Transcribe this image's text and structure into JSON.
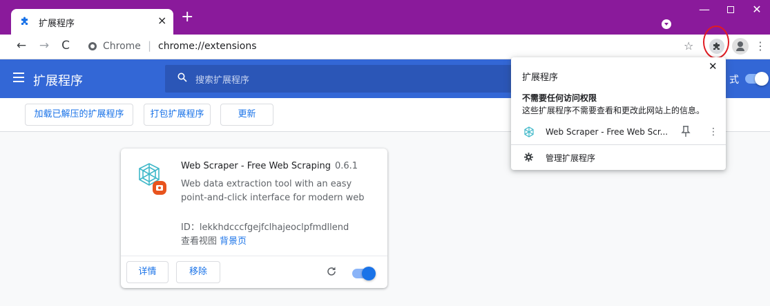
{
  "colors": {
    "titlebar": "#8a1a9b",
    "header": "#3367d6",
    "accent": "#1a73e8",
    "highlight_circle": "#e11b22"
  },
  "tab": {
    "title": "扩展程序",
    "icon": "puzzle-icon",
    "close": "×"
  },
  "new_tab": "+",
  "window_controls": {
    "minimize": "—",
    "close": "✕"
  },
  "omnibox": {
    "site_name": "Chrome",
    "separator": "|",
    "url": "chrome://extensions"
  },
  "nav": {
    "back": "←",
    "forward": "→",
    "reload": "C"
  },
  "toolbar_icons": [
    "star-icon",
    "puzzle-icon",
    "avatar-icon",
    "kebab-menu-icon"
  ],
  "star": "☆",
  "kebab": "⋮",
  "header": {
    "title": "扩展程序",
    "search_placeholder": "搜索扩展程序",
    "devmode_label": "式",
    "devmode_enabled": true
  },
  "actions": {
    "load_unpacked": "加载已解压的扩展程序",
    "pack": "打包扩展程序",
    "update": "更新"
  },
  "card": {
    "name": "Web Scraper - Free Web Scraping",
    "version": "0.6.1",
    "description": "Web data extraction tool with an easy point-and-click interface for modern web",
    "id_line": "ID：lekkhdcccfgejfclhajeoclpfmdllend",
    "views_label": "查看视图",
    "views_link": "背景页",
    "details": "详情",
    "remove": "移除",
    "enabled": true
  },
  "popup": {
    "title": "扩展程序",
    "close": "✕",
    "section_title": "不需要任何访问权限",
    "section_desc": "这些扩展程序不需要查看和更改此网站上的信息。",
    "extension_name": "Web Scraper - Free Web Scr...",
    "kebab": "⋮",
    "manage": "管理扩展程序"
  }
}
